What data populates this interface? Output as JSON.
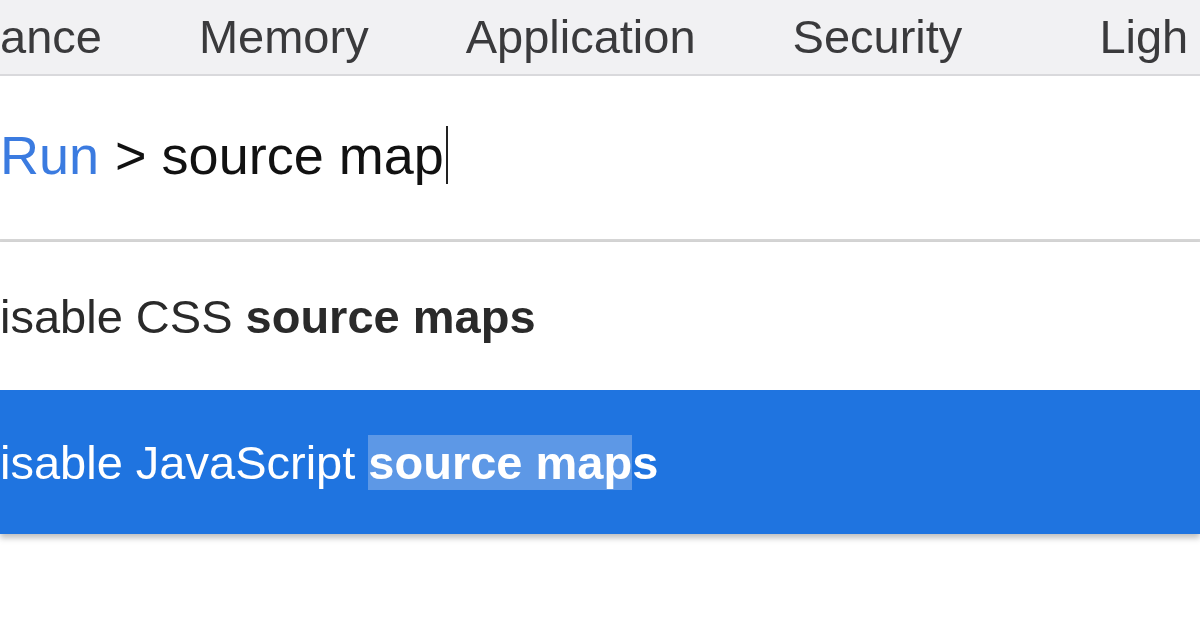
{
  "tabs": [
    {
      "label": "ance",
      "selected": false
    },
    {
      "label": "Memory",
      "selected": false
    },
    {
      "label": "Application",
      "selected": false
    },
    {
      "label": "Security",
      "selected": false
    },
    {
      "label": "Ligh",
      "selected": false
    }
  ],
  "command_input": {
    "prompt": "Run",
    "value": "> source map"
  },
  "results": [
    {
      "text": "isable CSS ",
      "match": "source map",
      "rest": "s",
      "selected": false
    },
    {
      "text": "isable JavaScript ",
      "match": "source map",
      "rest": "s",
      "selected": true
    }
  ]
}
